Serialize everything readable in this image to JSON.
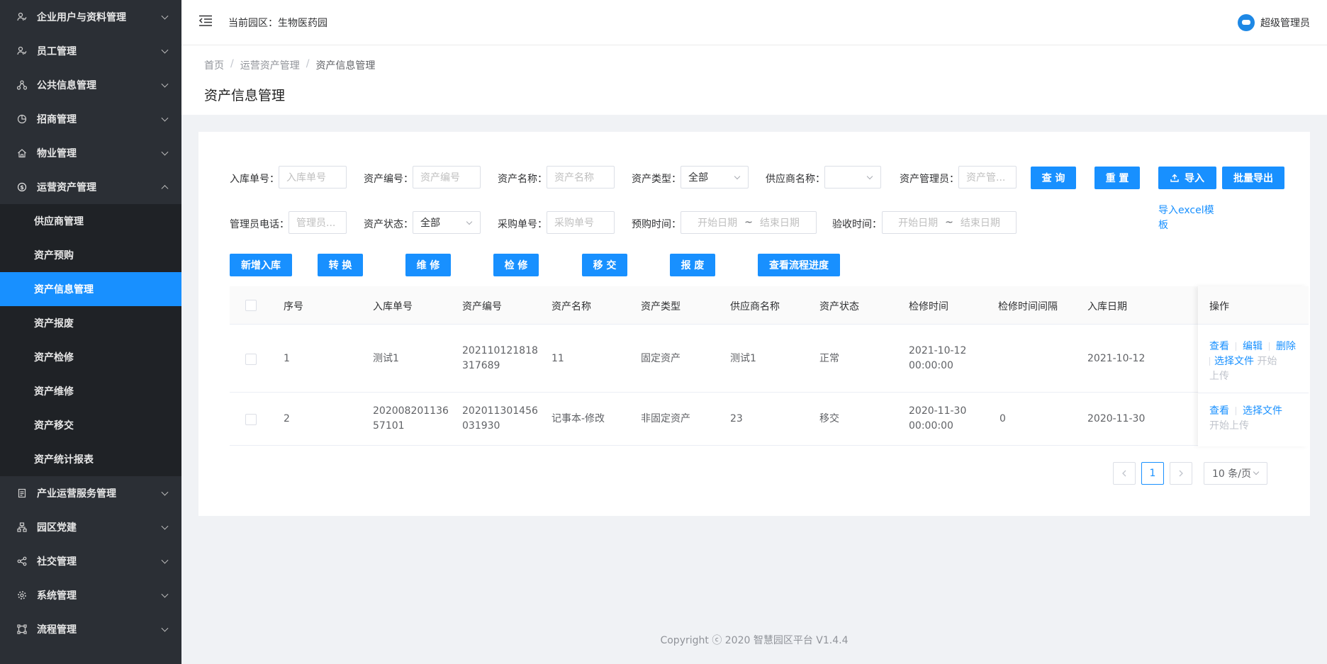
{
  "sidebar": {
    "items": [
      {
        "label": "企业用户与资料管理",
        "icon": "users-icon"
      },
      {
        "label": "员工管理",
        "icon": "user-icon"
      },
      {
        "label": "公共信息管理",
        "icon": "share-icon"
      },
      {
        "label": "招商管理",
        "icon": "pie-icon"
      },
      {
        "label": "物业管理",
        "icon": "home-icon"
      },
      {
        "label": "运营资产管理",
        "icon": "dollar-icon"
      }
    ],
    "sub_items": [
      {
        "label": "供应商管理"
      },
      {
        "label": "资产预购"
      },
      {
        "label": "资产信息管理"
      },
      {
        "label": "资产报废"
      },
      {
        "label": "资产检修"
      },
      {
        "label": "资产维修"
      },
      {
        "label": "资产移交"
      },
      {
        "label": "资产统计报表"
      }
    ],
    "items_after": [
      {
        "label": "产业运营服务管理",
        "icon": "doc-icon"
      },
      {
        "label": "园区党建",
        "icon": "org-icon"
      },
      {
        "label": "社交管理",
        "icon": "share-icon"
      },
      {
        "label": "系统管理",
        "icon": "gear-icon"
      },
      {
        "label": "流程管理",
        "icon": "flow-icon"
      }
    ]
  },
  "header": {
    "park_label": "当前园区：生物医药园",
    "user_name": "超级管理员"
  },
  "breadcrumb": [
    "首页",
    "运营资产管理",
    "资产信息管理"
  ],
  "page_title": "资产信息管理",
  "filters": {
    "inbound_no": {
      "label": "入库单号：",
      "placeholder": "入库单号"
    },
    "asset_no": {
      "label": "资产编号：",
      "placeholder": "资产编号"
    },
    "asset_name": {
      "label": "资产名称：",
      "placeholder": "资产名称"
    },
    "asset_type": {
      "label": "资产类型：",
      "value": "全部"
    },
    "supplier": {
      "label": "供应商名称：",
      "value": ""
    },
    "asset_manager": {
      "label": "资产管理员：",
      "placeholder": "资产管..."
    },
    "manager_phone": {
      "label": "管理员电话：",
      "placeholder": "管理员..."
    },
    "asset_status": {
      "label": "资产状态：",
      "value": "全部"
    },
    "purchase_no": {
      "label": "采购单号：",
      "placeholder": "采购单号"
    },
    "prepurchase_time": {
      "label": "预购时间：",
      "start": "开始日期",
      "end": "结束日期"
    },
    "accept_time": {
      "label": "验收时间：",
      "start": "开始日期",
      "end": "结束日期"
    },
    "range_sep": "~"
  },
  "buttons": {
    "query": "查 询",
    "reset": "重 置",
    "import": "导入",
    "batch_export": "批量导出",
    "template": "导入excel模板",
    "add_inbound": "新增入库",
    "convert": "转 换",
    "maintain": "维 修",
    "inspect": "检 修",
    "transfer": "移 交",
    "scrap": "报 废",
    "process": "查看流程进度"
  },
  "table": {
    "headers": [
      "序号",
      "入库单号",
      "资产编号",
      "资产名称",
      "资产类型",
      "供应商名称",
      "资产状态",
      "检修时间",
      "检修时间间隔",
      "入库日期",
      "操作"
    ],
    "rows": [
      {
        "index": "1",
        "inbound_no": "测试1",
        "asset_no": "202110121818317689",
        "asset_no_l1": "202110121818",
        "asset_no_l2": "317689",
        "asset_name": "11",
        "asset_type": "固定资产",
        "supplier": "测试1",
        "status": "正常",
        "inspect_date": "2021-10-12",
        "inspect_time": "00:00:00",
        "interval": "",
        "inbound_date": "2021-10-12",
        "ops": {
          "view": "查看",
          "edit": "编辑",
          "delete": "删除",
          "choose": "选择文件",
          "upload_a": "开始",
          "upload_b": "上传"
        }
      },
      {
        "index": "2",
        "inbound_no_l1": "202008201136",
        "inbound_no_l2": "57101",
        "asset_no_l1": "202011301456",
        "asset_no_l2": "031930",
        "asset_name": "记事本-修改",
        "asset_type": "非固定资产",
        "supplier": "23",
        "status": "移交",
        "inspect_date": "2020-11-30",
        "inspect_time": "00:00:00",
        "interval": "0",
        "inbound_date": "2020-11-30",
        "ops": {
          "view": "查看",
          "choose": "选择文件",
          "upload": "开始上传"
        }
      }
    ]
  },
  "pagination": {
    "current": "1",
    "page_size": "10 条/页"
  },
  "footer": "Copyright ⓒ 2020 智慧园区平台 V1.4.4",
  "colors": {
    "primary": "#1890ff",
    "sidebar": "#2b2f35",
    "submenu": "#1f2226"
  }
}
